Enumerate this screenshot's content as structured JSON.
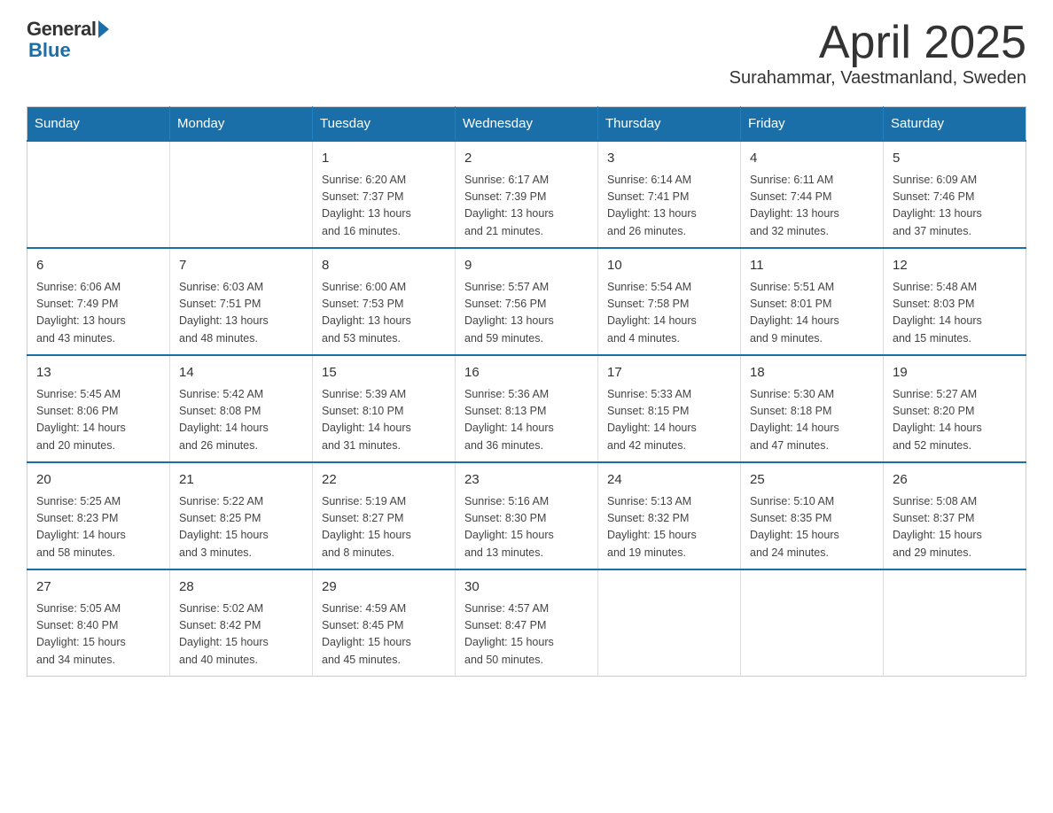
{
  "logo": {
    "general": "General",
    "blue": "Blue"
  },
  "header": {
    "month": "April 2025",
    "location": "Surahammar, Vaestmanland, Sweden"
  },
  "weekdays": [
    "Sunday",
    "Monday",
    "Tuesday",
    "Wednesday",
    "Thursday",
    "Friday",
    "Saturday"
  ],
  "weeks": [
    [
      {
        "day": "",
        "info": ""
      },
      {
        "day": "",
        "info": ""
      },
      {
        "day": "1",
        "info": "Sunrise: 6:20 AM\nSunset: 7:37 PM\nDaylight: 13 hours\nand 16 minutes."
      },
      {
        "day": "2",
        "info": "Sunrise: 6:17 AM\nSunset: 7:39 PM\nDaylight: 13 hours\nand 21 minutes."
      },
      {
        "day": "3",
        "info": "Sunrise: 6:14 AM\nSunset: 7:41 PM\nDaylight: 13 hours\nand 26 minutes."
      },
      {
        "day": "4",
        "info": "Sunrise: 6:11 AM\nSunset: 7:44 PM\nDaylight: 13 hours\nand 32 minutes."
      },
      {
        "day": "5",
        "info": "Sunrise: 6:09 AM\nSunset: 7:46 PM\nDaylight: 13 hours\nand 37 minutes."
      }
    ],
    [
      {
        "day": "6",
        "info": "Sunrise: 6:06 AM\nSunset: 7:49 PM\nDaylight: 13 hours\nand 43 minutes."
      },
      {
        "day": "7",
        "info": "Sunrise: 6:03 AM\nSunset: 7:51 PM\nDaylight: 13 hours\nand 48 minutes."
      },
      {
        "day": "8",
        "info": "Sunrise: 6:00 AM\nSunset: 7:53 PM\nDaylight: 13 hours\nand 53 minutes."
      },
      {
        "day": "9",
        "info": "Sunrise: 5:57 AM\nSunset: 7:56 PM\nDaylight: 13 hours\nand 59 minutes."
      },
      {
        "day": "10",
        "info": "Sunrise: 5:54 AM\nSunset: 7:58 PM\nDaylight: 14 hours\nand 4 minutes."
      },
      {
        "day": "11",
        "info": "Sunrise: 5:51 AM\nSunset: 8:01 PM\nDaylight: 14 hours\nand 9 minutes."
      },
      {
        "day": "12",
        "info": "Sunrise: 5:48 AM\nSunset: 8:03 PM\nDaylight: 14 hours\nand 15 minutes."
      }
    ],
    [
      {
        "day": "13",
        "info": "Sunrise: 5:45 AM\nSunset: 8:06 PM\nDaylight: 14 hours\nand 20 minutes."
      },
      {
        "day": "14",
        "info": "Sunrise: 5:42 AM\nSunset: 8:08 PM\nDaylight: 14 hours\nand 26 minutes."
      },
      {
        "day": "15",
        "info": "Sunrise: 5:39 AM\nSunset: 8:10 PM\nDaylight: 14 hours\nand 31 minutes."
      },
      {
        "day": "16",
        "info": "Sunrise: 5:36 AM\nSunset: 8:13 PM\nDaylight: 14 hours\nand 36 minutes."
      },
      {
        "day": "17",
        "info": "Sunrise: 5:33 AM\nSunset: 8:15 PM\nDaylight: 14 hours\nand 42 minutes."
      },
      {
        "day": "18",
        "info": "Sunrise: 5:30 AM\nSunset: 8:18 PM\nDaylight: 14 hours\nand 47 minutes."
      },
      {
        "day": "19",
        "info": "Sunrise: 5:27 AM\nSunset: 8:20 PM\nDaylight: 14 hours\nand 52 minutes."
      }
    ],
    [
      {
        "day": "20",
        "info": "Sunrise: 5:25 AM\nSunset: 8:23 PM\nDaylight: 14 hours\nand 58 minutes."
      },
      {
        "day": "21",
        "info": "Sunrise: 5:22 AM\nSunset: 8:25 PM\nDaylight: 15 hours\nand 3 minutes."
      },
      {
        "day": "22",
        "info": "Sunrise: 5:19 AM\nSunset: 8:27 PM\nDaylight: 15 hours\nand 8 minutes."
      },
      {
        "day": "23",
        "info": "Sunrise: 5:16 AM\nSunset: 8:30 PM\nDaylight: 15 hours\nand 13 minutes."
      },
      {
        "day": "24",
        "info": "Sunrise: 5:13 AM\nSunset: 8:32 PM\nDaylight: 15 hours\nand 19 minutes."
      },
      {
        "day": "25",
        "info": "Sunrise: 5:10 AM\nSunset: 8:35 PM\nDaylight: 15 hours\nand 24 minutes."
      },
      {
        "day": "26",
        "info": "Sunrise: 5:08 AM\nSunset: 8:37 PM\nDaylight: 15 hours\nand 29 minutes."
      }
    ],
    [
      {
        "day": "27",
        "info": "Sunrise: 5:05 AM\nSunset: 8:40 PM\nDaylight: 15 hours\nand 34 minutes."
      },
      {
        "day": "28",
        "info": "Sunrise: 5:02 AM\nSunset: 8:42 PM\nDaylight: 15 hours\nand 40 minutes."
      },
      {
        "day": "29",
        "info": "Sunrise: 4:59 AM\nSunset: 8:45 PM\nDaylight: 15 hours\nand 45 minutes."
      },
      {
        "day": "30",
        "info": "Sunrise: 4:57 AM\nSunset: 8:47 PM\nDaylight: 15 hours\nand 50 minutes."
      },
      {
        "day": "",
        "info": ""
      },
      {
        "day": "",
        "info": ""
      },
      {
        "day": "",
        "info": ""
      }
    ]
  ]
}
